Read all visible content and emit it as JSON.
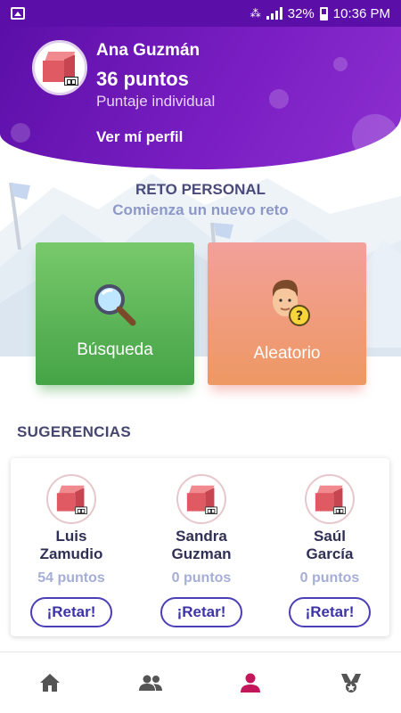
{
  "status_bar": {
    "battery": "32%",
    "time": "10:36 PM"
  },
  "user": {
    "name": "Ana Guzmán",
    "points": "36 puntos",
    "subtitle": "Puntaje individual",
    "profile_link": "Ver mí perfil"
  },
  "personal_challenge": {
    "title": "RETO PERSONAL",
    "subtitle": "Comienza un nuevo reto",
    "options": [
      {
        "label": "Búsqueda",
        "icon": "magnifier-icon",
        "color": "#4caf50"
      },
      {
        "label": "Aleatorio",
        "icon": "random-person-icon",
        "color": "#ef9a78"
      }
    ]
  },
  "suggestions": {
    "title": "SUGERENCIAS",
    "items": [
      {
        "name_line1": "Luis",
        "name_line2": "Zamudio",
        "points": "54 puntos",
        "button": "¡Retar!"
      },
      {
        "name_line1": "Sandra",
        "name_line2": "Guzman",
        "points": "0 puntos",
        "button": "¡Retar!"
      },
      {
        "name_line1": "Saúl",
        "name_line2": "García",
        "points": "0 puntos",
        "button": "¡Retar!"
      }
    ]
  },
  "bottom_nav": {
    "items": [
      {
        "icon": "home-icon",
        "active": false
      },
      {
        "icon": "group-icon",
        "active": false
      },
      {
        "icon": "person-icon",
        "active": true
      },
      {
        "icon": "trophy-icon",
        "active": false
      }
    ]
  },
  "colors": {
    "header": "#6a12b3",
    "accent": "#4b3fb8",
    "active_nav": "#c2185b",
    "inactive_nav": "#555555"
  }
}
